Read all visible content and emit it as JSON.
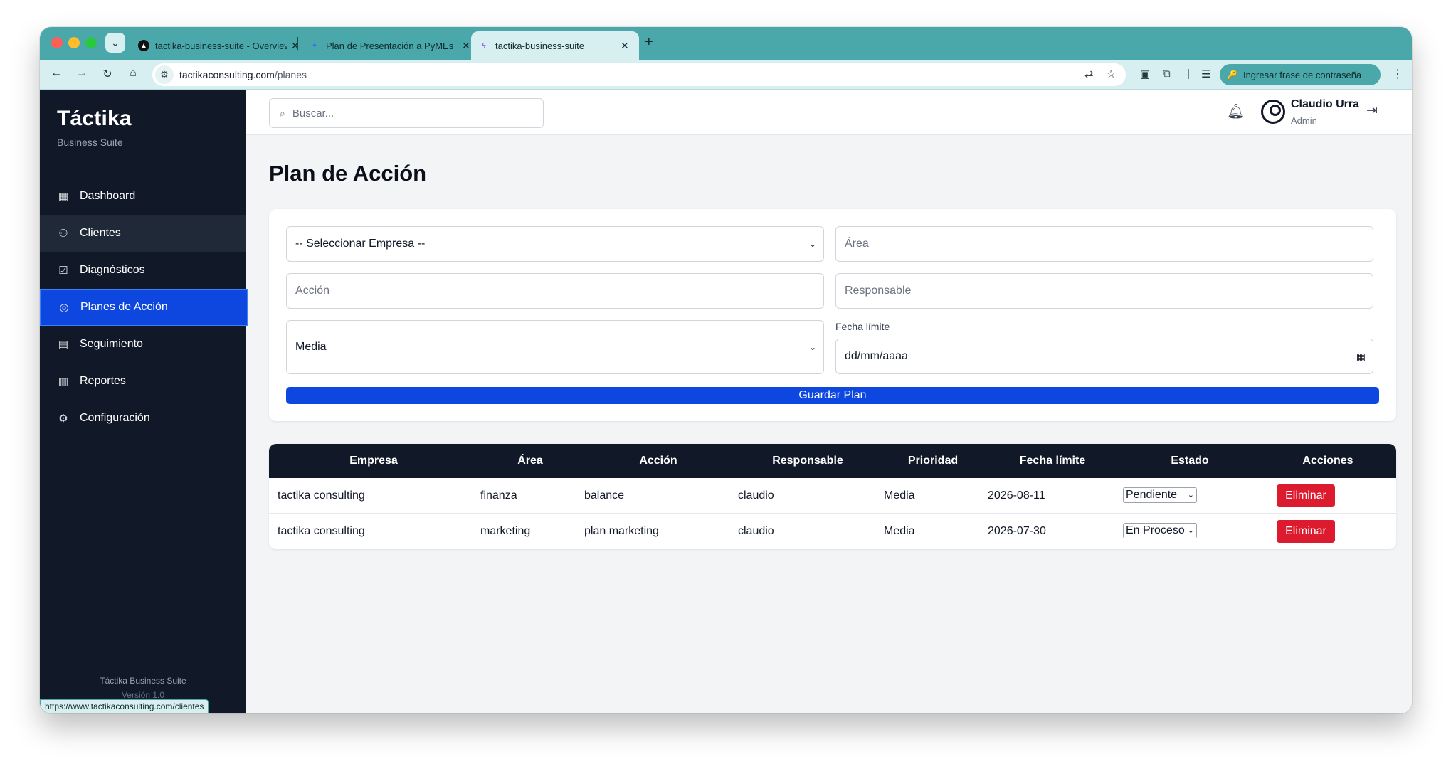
{
  "browser": {
    "tabs": [
      {
        "title": "tactika-business-suite - Overview",
        "favicon": "vercel-icon"
      },
      {
        "title": "Plan de Presentación a PyMEs",
        "favicon": "gemini-icon"
      },
      {
        "title": "tactika-business-suite",
        "favicon": "bolt-icon",
        "active": true
      }
    ],
    "url_host": "tactikaconsulting.com",
    "url_path": "/planes",
    "password_chip": "Ingresar frase de contraseña",
    "status_url": "https://www.tactikaconsulting.com/clientes"
  },
  "sidebar": {
    "brand_title": "Táctika",
    "brand_sub": "Business Suite",
    "items": [
      {
        "label": "Dashboard",
        "icon": "grid-icon"
      },
      {
        "label": "Clientes",
        "icon": "users-icon"
      },
      {
        "label": "Diagnósticos",
        "icon": "clipboard-icon"
      },
      {
        "label": "Planes de Acción",
        "icon": "target-icon"
      },
      {
        "label": "Seguimiento",
        "icon": "calendar-icon"
      },
      {
        "label": "Reportes",
        "icon": "bar-chart-icon"
      },
      {
        "label": "Configuración",
        "icon": "gear-icon"
      }
    ],
    "footer_title": "Táctika Business Suite",
    "footer_version": "Versión 1.0"
  },
  "topbar": {
    "search_placeholder": "Buscar...",
    "user_name": "Claudio Urra",
    "user_role": "Admin"
  },
  "page": {
    "title": "Plan de Acción"
  },
  "form": {
    "empresa_select": "-- Seleccionar Empresa --",
    "area_placeholder": "Área",
    "accion_placeholder": "Acción",
    "responsable_placeholder": "Responsable",
    "prioridad_select": "Media",
    "fecha_label": "Fecha límite",
    "fecha_value": "dd/mm/aaaa",
    "save_label": "Guardar Plan"
  },
  "table": {
    "headers": [
      "Empresa",
      "Área",
      "Acción",
      "Responsable",
      "Prioridad",
      "Fecha límite",
      "Estado",
      "Acciones"
    ],
    "rows": [
      {
        "empresa": "tactika consulting",
        "area": "finanza",
        "accion": "balance",
        "responsable": "claudio",
        "prioridad": "Media",
        "fecha": "2026-08-11",
        "estado": "Pendiente",
        "accion_btn": "Eliminar"
      },
      {
        "empresa": "tactika consulting",
        "area": "marketing",
        "accion": "plan marketing",
        "responsable": "claudio",
        "prioridad": "Media",
        "fecha": "2026-07-30",
        "estado": "En Proceso",
        "accion_btn": "Eliminar"
      }
    ]
  }
}
